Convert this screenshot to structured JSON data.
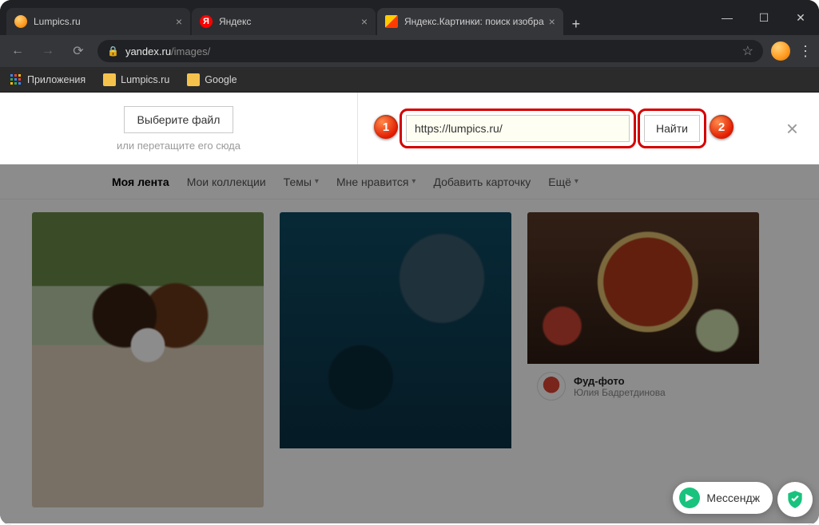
{
  "tabs": [
    {
      "title": "Lumpics.ru",
      "favicon_color": "#ff9a1f"
    },
    {
      "title": "Яндекс",
      "favicon_color": "#ff0000"
    },
    {
      "title": "Яндекс.Картинки: поиск изобра",
      "favicon_color": "#ffcc00"
    }
  ],
  "address_bar": {
    "host": "yandex.ru",
    "path": "/images/"
  },
  "bookmarks": {
    "apps": "Приложения",
    "b1": "Lumpics.ru",
    "b2": "Google"
  },
  "upload": {
    "choose_label": "Выберите файл",
    "drag_hint": "или перетащите его сюда",
    "url_value": "https://lumpics.ru/",
    "find_label": "Найти"
  },
  "annotations": {
    "n1": "1",
    "n2": "2"
  },
  "nav": {
    "feed": "Моя лента",
    "collections": "Мои коллекции",
    "topics": "Темы",
    "likes": "Мне нравится",
    "add_card": "Добавить карточку",
    "more": "Ещё"
  },
  "card3": {
    "title": "Фуд-фото",
    "author": "Юлия Бадретдинова"
  },
  "messenger": {
    "label": "Мессендж"
  }
}
